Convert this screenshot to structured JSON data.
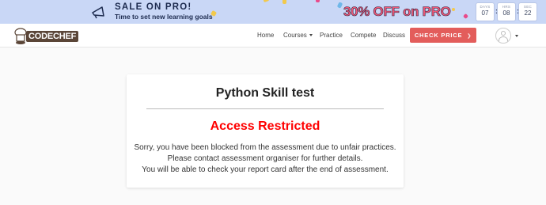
{
  "promo": {
    "title": "SALE ON PRO!",
    "subtitle": "Time to set new learning goals",
    "offer": "30% OFF on PRO",
    "countdown": [
      {
        "unit": "DAYS",
        "value": "07"
      },
      {
        "unit": "HRS",
        "value": "08"
      },
      {
        "unit": "SEC",
        "value": "22"
      }
    ]
  },
  "nav": {
    "logo_text": "CODECHEF",
    "links": [
      "Home",
      "Courses",
      "Practice",
      "Compete",
      "Discuss"
    ],
    "cta": "CHECK PRICE"
  },
  "card": {
    "title": "Python Skill test",
    "heading": "Access Restricted",
    "lines": [
      "Sorry, you have been blocked from the assessment due to unfair practices.",
      "Please contact assessment organiser for further details.",
      "You will be able to check your report card after the end of assessment."
    ]
  },
  "colors": {
    "promo_bg": "#c9d7f6",
    "cta_bg": "#e35d5b",
    "restricted": "#ff0000",
    "offer": "#f25a7a"
  }
}
